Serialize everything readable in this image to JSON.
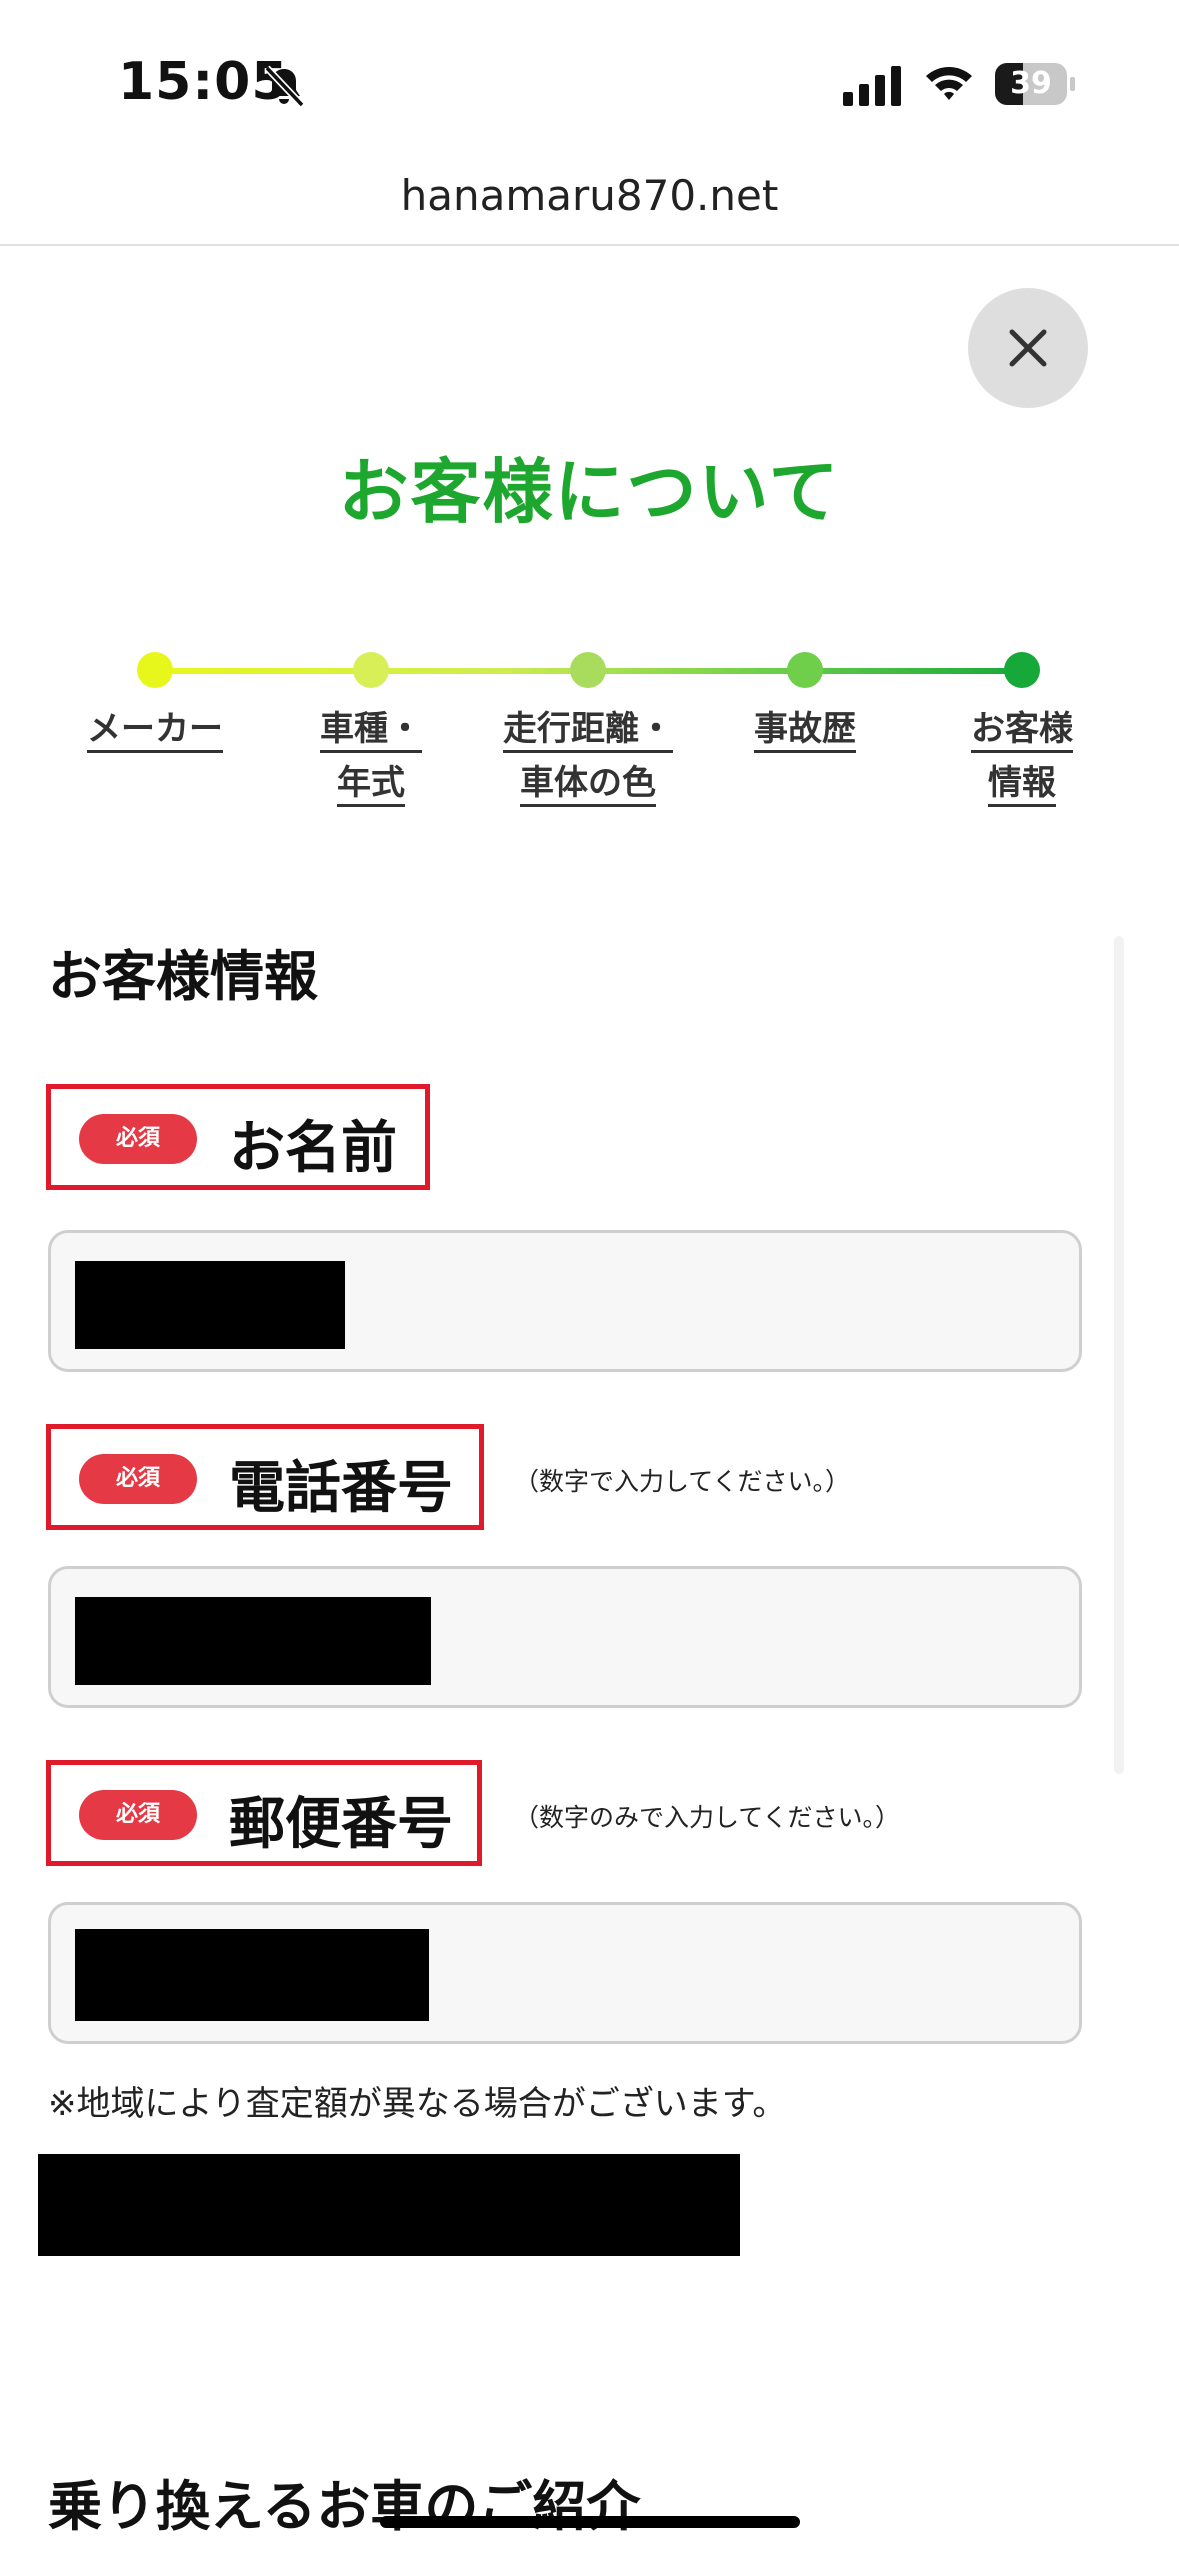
{
  "status": {
    "time": "15:05",
    "battery": "39",
    "battery_fraction": 0.39
  },
  "browser": {
    "url": "hanamaru870.net"
  },
  "page": {
    "title": "お客様について",
    "steps": [
      {
        "line1": "メーカー",
        "line2": "",
        "color": "#e8f71b"
      },
      {
        "line1": "車種・",
        "line2": "年式",
        "color": "#d8ef58"
      },
      {
        "line1": "走行距離・",
        "line2": "車体の色",
        "color": "#a9dc5c"
      },
      {
        "line1": "事故歴",
        "line2": "",
        "color": "#6fcf4a"
      },
      {
        "line1": "お客様",
        "line2": "情報",
        "color": "#17a83a"
      }
    ],
    "section_heading": "お客様情報",
    "required": "必須",
    "fields": {
      "name": {
        "label": "お名前"
      },
      "phone": {
        "label": "電話番号",
        "note": "（数字で入力してください。）"
      },
      "zip": {
        "label": "郵便番号",
        "note": "（数字のみで入力してください。）"
      }
    },
    "notice": "※地域により査定額が異なる場合がございます。",
    "next_heading": "乗り換えるお車のご紹介"
  },
  "colors": {
    "accent": "#1ea72f",
    "required": "#e63946",
    "highlight": "#e0192b"
  },
  "icons": {
    "bell": "bell-slash-icon",
    "signal": "cellular-signal-icon",
    "wifi": "wifi-icon",
    "close": "close-icon"
  }
}
